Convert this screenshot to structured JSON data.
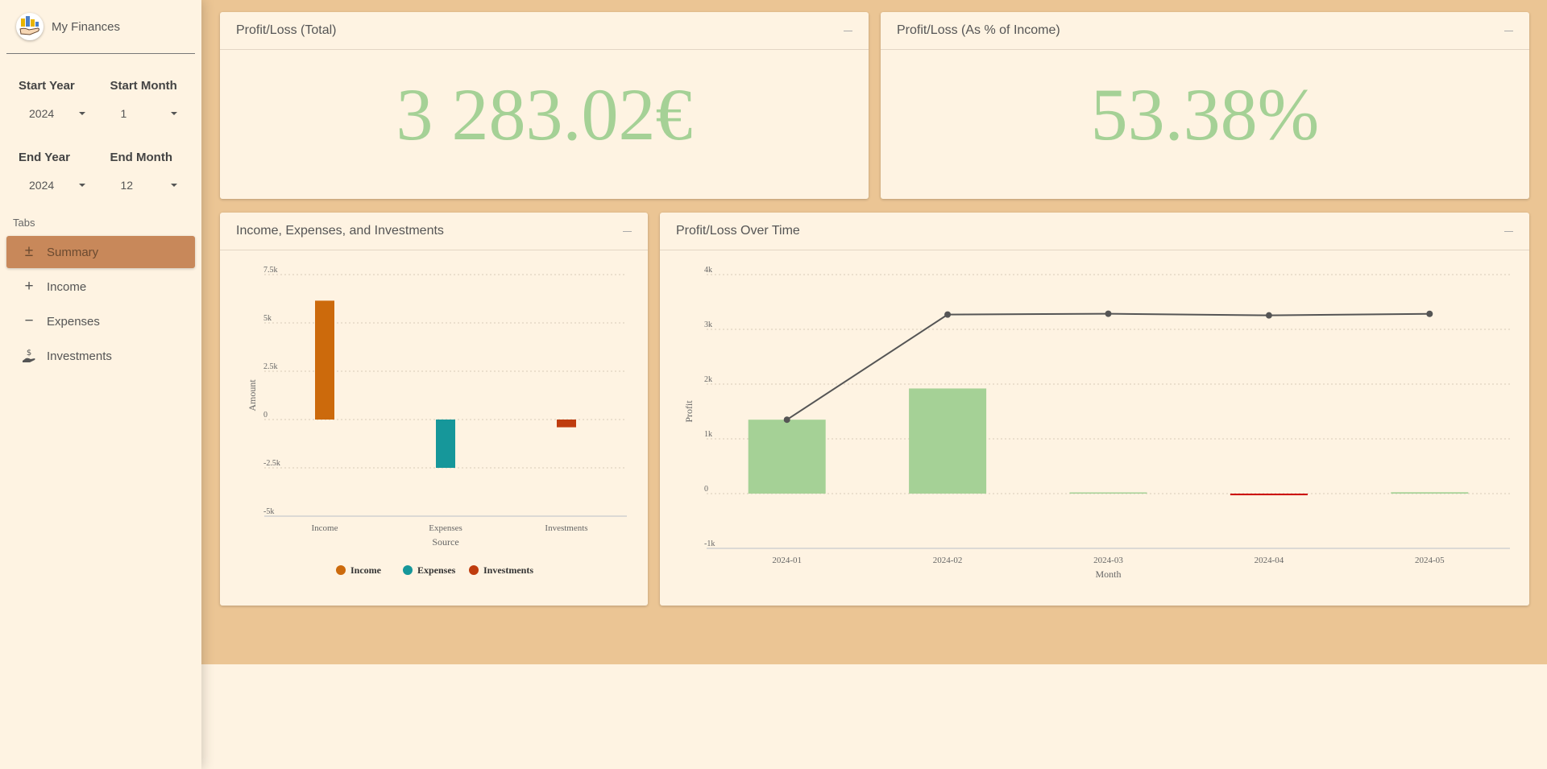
{
  "app": {
    "title": "My Finances"
  },
  "filters": {
    "start_year": {
      "label": "Start Year",
      "value": "2024"
    },
    "start_month": {
      "label": "Start Month",
      "value": "1"
    },
    "end_year": {
      "label": "End Year",
      "value": "2024"
    },
    "end_month": {
      "label": "End Month",
      "value": "12"
    }
  },
  "sidebar": {
    "tabs_label": "Tabs",
    "items": [
      {
        "label": "Summary",
        "icon": "plus-minus-icon",
        "active": true
      },
      {
        "label": "Income",
        "icon": "plus-icon"
      },
      {
        "label": "Expenses",
        "icon": "minus-icon"
      },
      {
        "label": "Investments",
        "icon": "hand-dollar-icon"
      }
    ]
  },
  "cards": {
    "total": {
      "title": "Profit/Loss (Total)",
      "value": "3 283.02€"
    },
    "percent": {
      "title": "Profit/Loss (As % of Income)",
      "value": "53.38%"
    },
    "iei": {
      "title": "Income, Expenses, and Investments"
    },
    "overtime": {
      "title": "Profit/Loss Over Time"
    }
  },
  "colors": {
    "accent": "#c8885a",
    "profit": "#a5d196",
    "loss": "#cc0000",
    "income": "#cc6a0c",
    "expenses": "#16979a",
    "investments": "#bf3c0e"
  },
  "chart_data": [
    {
      "type": "bar",
      "categories": [
        "Income",
        "Expenses",
        "Investments"
      ],
      "values": [
        6150,
        -2500,
        -400
      ],
      "colors": [
        "#cc6a0c",
        "#16979a",
        "#bf3c0e"
      ],
      "legend": [
        "Income",
        "Expenses",
        "Investments"
      ],
      "legend_position": "bottom",
      "xlabel": "Source",
      "ylabel": "Amount",
      "ylim": [
        -5000,
        7500
      ],
      "yticks": [
        "7.5k",
        "5k",
        "2.5k",
        "0",
        "-2.5k",
        "-5k"
      ],
      "grid": true
    },
    {
      "type": "bar+line",
      "categories": [
        "2024-01",
        "2024-02",
        "2024-03",
        "2024-04",
        "2024-05"
      ],
      "values": [
        1350,
        1920,
        15,
        -30,
        25
      ],
      "line_values": [
        1350,
        3270,
        3285,
        3255,
        3283
      ],
      "xlabel": "Month",
      "ylabel": "Profit",
      "ylim": [
        -1000,
        4000
      ],
      "yticks": [
        "4k",
        "3k",
        "2k",
        "1k",
        "0",
        "-1k"
      ],
      "grid": true
    }
  ]
}
